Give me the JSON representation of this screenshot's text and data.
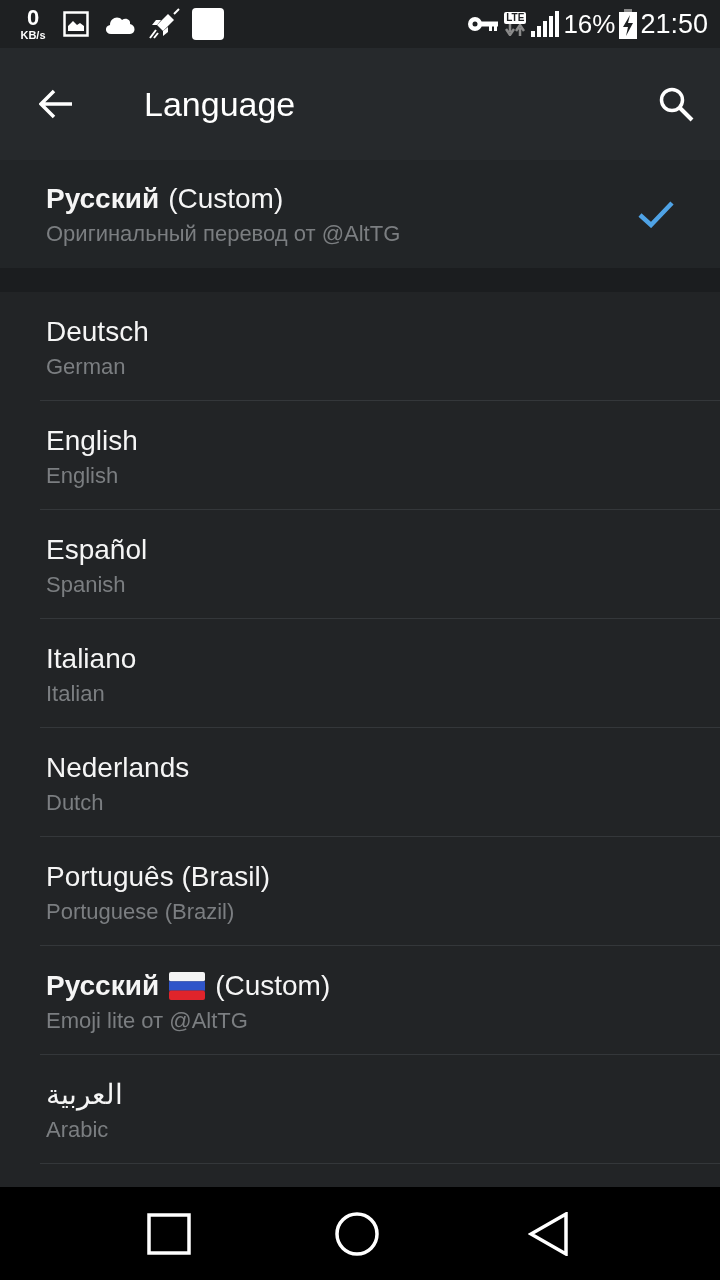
{
  "status_bar": {
    "net_speed": "0",
    "net_unit": "KB/s",
    "network_type": "LTE",
    "battery": "16%",
    "time": "21:50"
  },
  "app_bar": {
    "title": "Language"
  },
  "current": [
    {
      "kind": "custom",
      "name": "Русский",
      "suffix": "(Custom)",
      "subtitle": "Оригинальный перевод от @AltTG",
      "selected": true
    }
  ],
  "languages": [
    {
      "kind": "plain",
      "name": "Deutsch",
      "subtitle": "German",
      "selected": false
    },
    {
      "kind": "plain",
      "name": "English",
      "subtitle": "English",
      "selected": false
    },
    {
      "kind": "plain",
      "name": "Español",
      "subtitle": "Spanish",
      "selected": false
    },
    {
      "kind": "plain",
      "name": "Italiano",
      "subtitle": "Italian",
      "selected": false
    },
    {
      "kind": "plain",
      "name": "Nederlands",
      "subtitle": "Dutch",
      "selected": false
    },
    {
      "kind": "plain",
      "name": "Português (Brasil)",
      "subtitle": "Portuguese (Brazil)",
      "selected": false
    },
    {
      "kind": "custom",
      "name": "Русский",
      "flag": true,
      "suffix": "(Custom)",
      "subtitle": "Emoji lite от @AltTG",
      "selected": false
    },
    {
      "kind": "plain",
      "name": "العربية",
      "subtitle": "Arabic",
      "selected": false
    }
  ]
}
